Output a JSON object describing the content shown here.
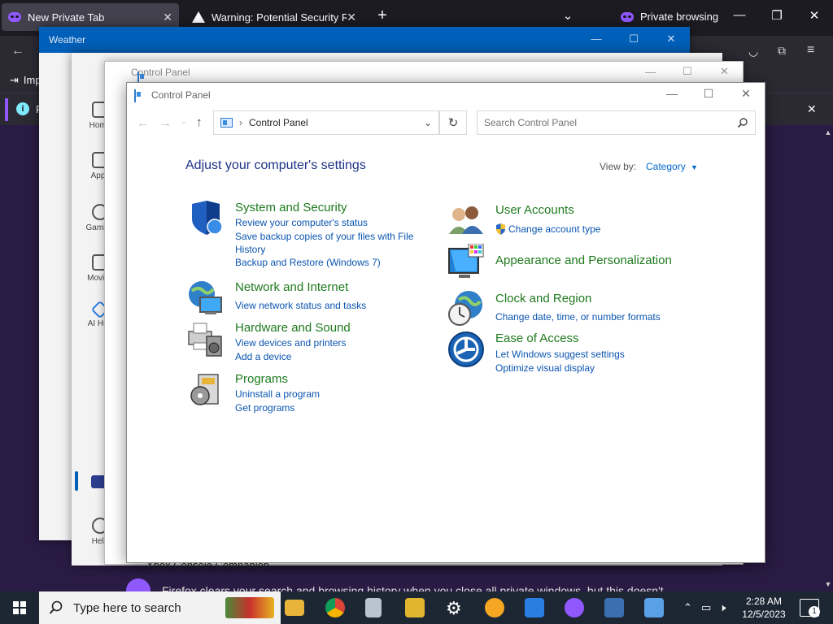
{
  "firefox": {
    "tabs": [
      {
        "label": "New Private Tab"
      },
      {
        "label": "Warning: Potential Security Risk"
      }
    ],
    "private_label": "Private browsing",
    "bookmark_label": "Imp",
    "info_label": "F",
    "hint_text": "Firefox clears your search and browsing history when you close all private windows, but this doesn't",
    "accent": "#9059ff"
  },
  "weather": {
    "title": "Weather"
  },
  "store": {
    "rail": [
      {
        "label": "Home"
      },
      {
        "label": "Apps"
      },
      {
        "label": "Gaming"
      },
      {
        "label": "Movies"
      },
      {
        "label": "AI Hub"
      },
      {
        "label": "Help"
      }
    ],
    "footer_text": "Xbox Console Companion"
  },
  "control_panel_back": {
    "title": "Control Panel"
  },
  "control_panel": {
    "title": "Control Panel",
    "address": "Control Panel",
    "search_placeholder": "Search Control Panel",
    "heading": "Adjust your computer's settings",
    "view_by_label": "View by:",
    "view_by_value": "Category",
    "categories": [
      {
        "title": "System and Security",
        "icon": "shield-icon",
        "links": [
          "Review your computer's status",
          "Save backup copies of your files with File History",
          "Backup and Restore (Windows 7)"
        ]
      },
      {
        "title": "Network and Internet",
        "icon": "network-globe-icon",
        "links": [
          "View network status and tasks"
        ]
      },
      {
        "title": "Hardware and Sound",
        "icon": "printer-speaker-icon",
        "links": [
          "View devices and printers",
          "Add a device"
        ]
      },
      {
        "title": "Programs",
        "icon": "programs-disc-icon",
        "links": [
          "Uninstall a program",
          "Get programs"
        ]
      },
      {
        "title": "User Accounts",
        "icon": "users-icon",
        "links": [
          "Change account type"
        ]
      },
      {
        "title": "Appearance and Personalization",
        "icon": "monitor-palette-icon",
        "links": []
      },
      {
        "title": "Clock and Region",
        "icon": "clock-globe-icon",
        "links": [
          "Change date, time, or number formats"
        ]
      },
      {
        "title": "Ease of Access",
        "icon": "ease-of-access-icon",
        "links": [
          "Let Windows suggest settings",
          "Optimize visual display"
        ]
      }
    ],
    "title_color": "#1e7a1e",
    "link_color": "#0a55b0"
  },
  "taskbar": {
    "search_placeholder": "Type here to search",
    "time": "2:28 AM",
    "date": "12/5/2023",
    "notification_count": "1"
  }
}
